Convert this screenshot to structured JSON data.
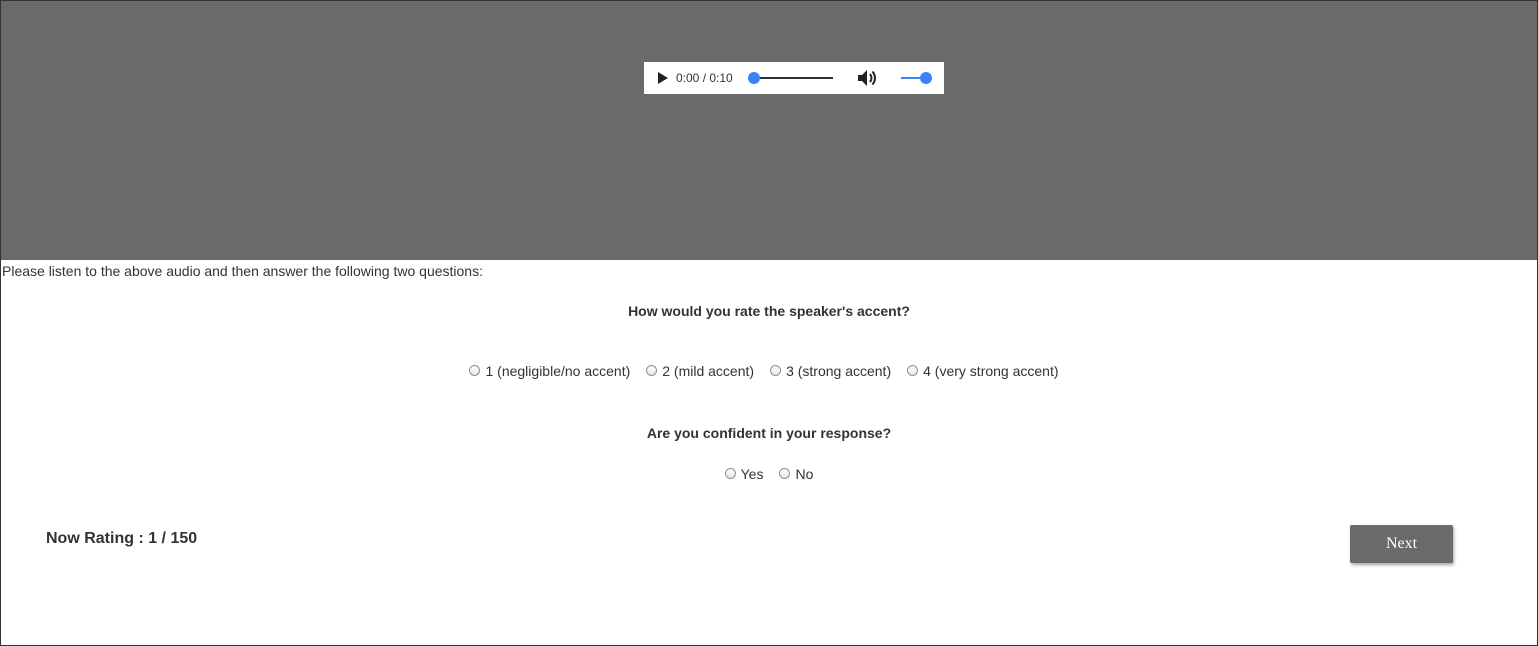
{
  "audio": {
    "time_display": "0:00 / 0:10",
    "progress_fraction": 0.0,
    "volume_fraction": 1.0,
    "play_icon": "play-icon",
    "volume_icon": "speaker-volume-icon",
    "accent_color": "#3b82f6"
  },
  "instructions": "Please listen to the above audio and then answer the following two questions:",
  "question1": {
    "text": "How would you rate the speaker's accent?",
    "options": [
      "1 (negligible/no accent)",
      "2 (mild accent)",
      "3 (strong accent)",
      "4 (very strong accent)"
    ]
  },
  "question2": {
    "text": "Are you confident in your response?",
    "options": [
      "Yes",
      "No"
    ]
  },
  "status": {
    "text": "Now Rating : 1 / 150"
  },
  "next_button": {
    "label": "Next"
  },
  "colors": {
    "header_band": "#6a6a6a",
    "button_bg": "#6a6a6a"
  }
}
